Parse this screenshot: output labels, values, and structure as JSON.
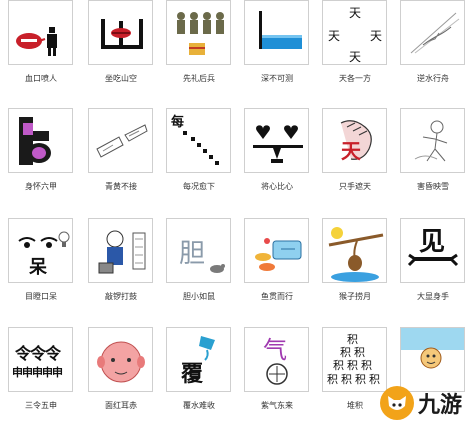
{
  "items": [
    {
      "caption": "血口喷人"
    },
    {
      "caption": "坐吃山空"
    },
    {
      "caption": "先礼后兵"
    },
    {
      "caption": "深不可测"
    },
    {
      "caption": "天各一方"
    },
    {
      "caption": "逆水行舟"
    },
    {
      "caption": "身怀六甲"
    },
    {
      "caption": "青黄不接"
    },
    {
      "caption": "每况愈下"
    },
    {
      "caption": "将心比心"
    },
    {
      "caption": "只手遮天"
    },
    {
      "caption": "害昏映雪"
    },
    {
      "caption": "目瞪口呆"
    },
    {
      "caption": "敲锣打鼓"
    },
    {
      "caption": "胆小如鼠"
    },
    {
      "caption": "鱼贯而行"
    },
    {
      "caption": "猴子捞月"
    },
    {
      "caption": "大显身手"
    },
    {
      "caption": "三令五申"
    },
    {
      "caption": "面红耳赤"
    },
    {
      "caption": "覆水难收"
    },
    {
      "caption": "紫气东来"
    },
    {
      "caption": "堆积"
    },
    {
      "caption": ""
    }
  ],
  "glyphs": {
    "tian": "天",
    "mei": "每",
    "ling": "令令令",
    "shen": "申申申申申",
    "fu": "覆",
    "qi": "气",
    "ji": "积",
    "dan": "胆",
    "chang": "呆",
    "xin": "心",
    "jian": "见"
  },
  "watermark": {
    "text": "九游"
  }
}
